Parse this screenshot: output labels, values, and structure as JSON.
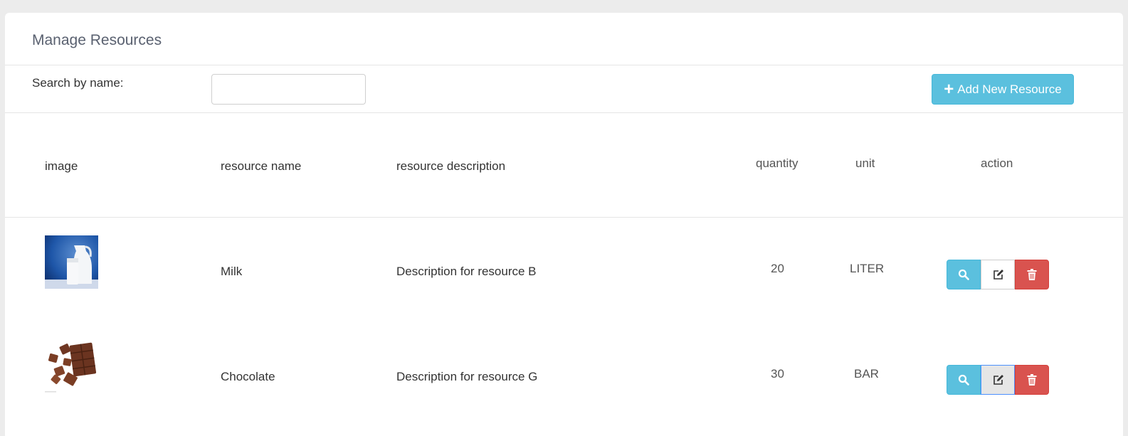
{
  "page": {
    "title": "Manage Resources"
  },
  "search": {
    "label": "Search by name:",
    "value": "",
    "placeholder": ""
  },
  "add_button": {
    "label": "Add New Resource"
  },
  "table": {
    "headers": {
      "image": "image",
      "name": "resource name",
      "description": "resource description",
      "quantity": "quantity",
      "unit": "unit",
      "action": "action"
    },
    "rows": [
      {
        "image_icon": "milk-image",
        "name": "Milk",
        "description": "Description for resource B",
        "quantity": "20",
        "unit": "LITER"
      },
      {
        "image_icon": "chocolate-image",
        "name": "Chocolate",
        "description": "Description for resource G",
        "quantity": "30",
        "unit": "BAR"
      }
    ]
  },
  "icons": {
    "view": "search-icon",
    "edit": "edit-icon",
    "delete": "trash-icon",
    "add": "plus-icon"
  },
  "colors": {
    "info": "#5bc0de",
    "danger": "#d9534f",
    "title": "#5a6170"
  }
}
